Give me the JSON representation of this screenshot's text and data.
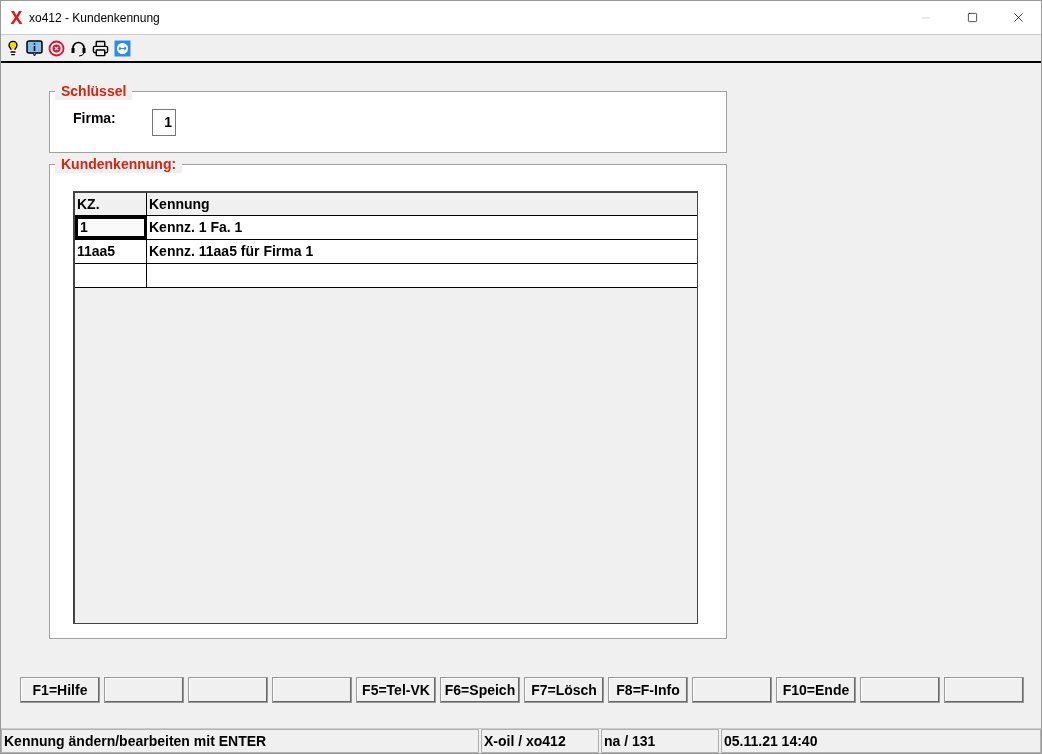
{
  "window": {
    "title": "xo412 - Kundenkennung"
  },
  "schluessel": {
    "title": "Schlüssel",
    "field_label": "Firma:",
    "field_value": "1"
  },
  "kundenkennung": {
    "title": "Kundenkennung:",
    "columns": [
      "KZ.",
      "Kennung"
    ],
    "rows": [
      {
        "cells": [
          "1",
          "Kennz. 1 Fa. 1"
        ],
        "selected": true
      },
      {
        "cells": [
          "11aa5",
          "Kennz. 11aa5 für Firma 1"
        ],
        "selected": false
      }
    ]
  },
  "function_keys": [
    {
      "kind": "key",
      "label": "F1=Hilfe"
    },
    {
      "kind": "blank"
    },
    {
      "kind": "blank"
    },
    {
      "kind": "blank"
    },
    {
      "kind": "key",
      "label": "F5=Tel-VK"
    },
    {
      "kind": "key",
      "label": "F6=Speich"
    },
    {
      "kind": "key",
      "label": "F7=Lösch"
    },
    {
      "kind": "key",
      "label": "F8=F-Info"
    },
    {
      "kind": "blank"
    },
    {
      "kind": "key",
      "label": "F10=Ende"
    },
    {
      "kind": "blank"
    },
    {
      "kind": "blank"
    }
  ],
  "status_bar": [
    "Kennung ändern/bearbeiten mit ENTER",
    "X-oil / xo412",
    "na / 131",
    "05.11.21 14:40"
  ]
}
